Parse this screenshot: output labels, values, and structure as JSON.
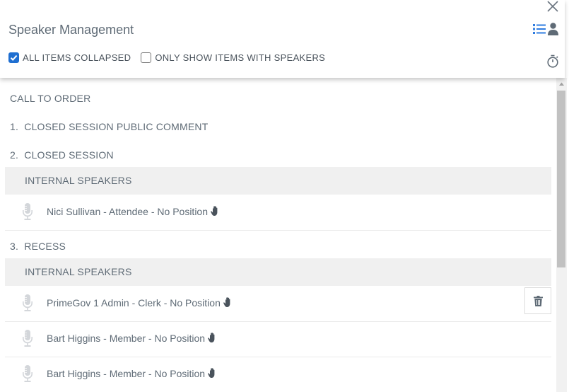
{
  "dialog": {
    "title": "Speaker Management"
  },
  "options": {
    "collapsed_label": "ALL ITEMS COLLAPSED",
    "collapsed_checked": true,
    "speakers_only_label": "ONLY SHOW ITEMS WITH SPEAKERS",
    "speakers_only_checked": false
  },
  "icons": {
    "close": "close-icon",
    "list_view": "list-icon",
    "speaker_view": "person-icon",
    "timer": "stopwatch-icon",
    "mic": "microphone-icon",
    "hand": "hand-icon",
    "delete": "trash-icon"
  },
  "colors": {
    "accent": "#1f6fd1",
    "band": "#f0f0f0",
    "text": "#5f6b76"
  },
  "agenda": {
    "call_to_order": "CALL TO ORDER",
    "items": [
      {
        "number": "1.",
        "title": "CLOSED SESSION PUBLIC COMMENT"
      },
      {
        "number": "2.",
        "title": "CLOSED SESSION"
      },
      {
        "number": "3.",
        "title": "RECESS"
      }
    ]
  },
  "sections": [
    {
      "label": "INTERNAL SPEAKERS",
      "speakers": [
        "Nici Sullivan - Attendee - No Position"
      ]
    },
    {
      "label": "INTERNAL SPEAKERS",
      "speakers": [
        "PrimeGov 1 Admin - Clerk - No Position",
        "Bart Higgins - Member - No Position",
        "Bart Higgins - Member - No Position"
      ]
    }
  ]
}
